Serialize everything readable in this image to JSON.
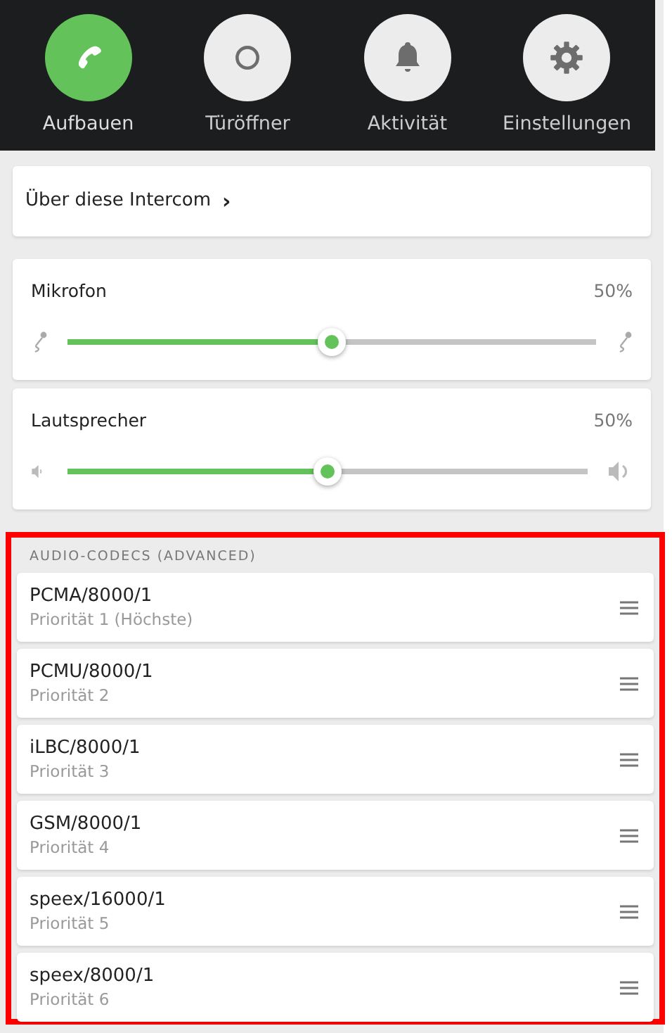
{
  "actions": [
    {
      "label": "Aufbauen",
      "kind": "phone",
      "selected": true
    },
    {
      "label": "Türöffner",
      "kind": "ring",
      "selected": false
    },
    {
      "label": "Aktivität",
      "kind": "bell",
      "selected": false
    },
    {
      "label": "Einstellungen",
      "kind": "gear",
      "selected": false
    }
  ],
  "about_link": {
    "label": "Über diese Intercom",
    "chevron": "›"
  },
  "sliders": [
    {
      "kind": "microphone",
      "label": "Mikrofon",
      "reading": "50%",
      "level": 0.5
    },
    {
      "kind": "speaker",
      "label": "Lautsprecher",
      "reading": "50%",
      "level": 0.5
    }
  ],
  "codecs": {
    "highlighted": true,
    "heading": "AUDIO-CODECS (ADVANCED)",
    "items": [
      {
        "name": "PCMA/8000/1",
        "priority": "Priorität 1 (Höchste)"
      },
      {
        "name": "PCMU/8000/1",
        "priority": "Priorität 2"
      },
      {
        "name": "iLBC/8000/1",
        "priority": "Priorität 3"
      },
      {
        "name": "GSM/8000/1",
        "priority": "Priorität 4"
      },
      {
        "name": "speex/16000/1",
        "priority": "Priorität 5"
      },
      {
        "name": "speex/8000/1",
        "priority": "Priorität 6"
      }
    ]
  }
}
